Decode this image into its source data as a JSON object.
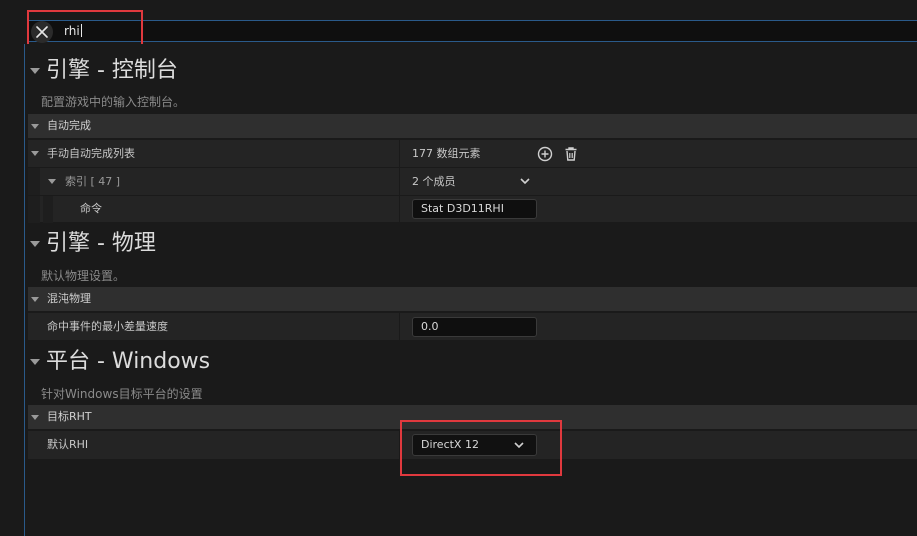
{
  "search": {
    "value": "rhi"
  },
  "categories": [
    {
      "title": "引擎 - 控制台",
      "description": "配置游戏中的输入控制台。",
      "section": "自动完成",
      "rows": {
        "list_label": "手动自动完成列表",
        "list_value": "177 数组元素",
        "index_label": "索引 [ 47 ]",
        "index_value": "2 个成员",
        "command_label": "命令",
        "command_value": "Stat D3D11RHI"
      }
    },
    {
      "title": "引擎 - 物理",
      "description": "默认物理设置。",
      "section": "混沌物理",
      "rows": {
        "hit_label": "命中事件的最小差量速度",
        "hit_value": "0.0"
      }
    },
    {
      "title": "平台 - Windows",
      "description": "针对Windows目标平台的设置",
      "section": "目标RHT",
      "rows": {
        "rhi_label": "默认RHI",
        "rhi_value": "DirectX 12"
      }
    }
  ],
  "icons": {
    "clear": "close-icon",
    "add": "plus-circle-icon",
    "delete": "trash-icon",
    "expand": "chevron-down-icon"
  },
  "colors": {
    "highlight": "#e0393e",
    "focus_border": "#2a5a8a",
    "background": "#1a1a1a"
  }
}
